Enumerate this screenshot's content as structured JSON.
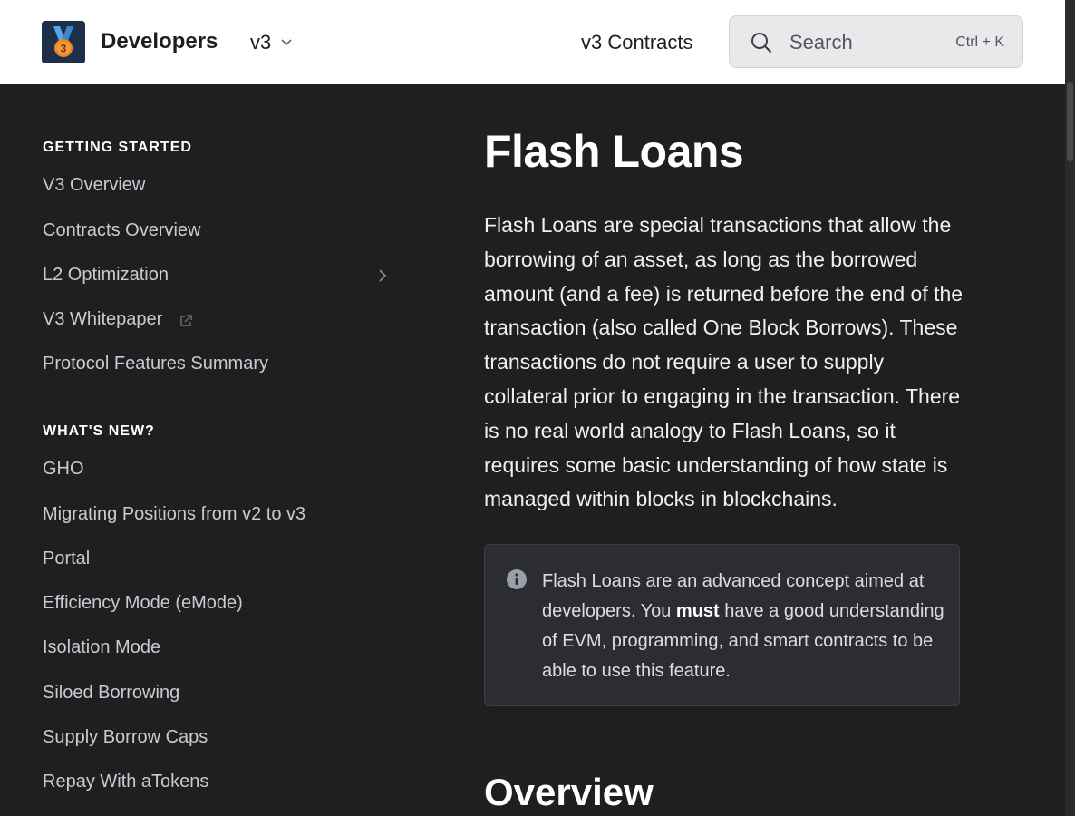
{
  "header": {
    "brand": "Developers",
    "version": "v3",
    "nav_link": "v3 Contracts",
    "search": {
      "label": "Search",
      "shortcut": "Ctrl + K"
    }
  },
  "sidebar": {
    "sections": [
      {
        "title": "GETTING STARTED",
        "items": [
          {
            "label": "V3 Overview"
          },
          {
            "label": "Contracts Overview"
          },
          {
            "label": "L2 Optimization"
          },
          {
            "label": "V3 Whitepaper"
          },
          {
            "label": "Protocol Features Summary"
          }
        ]
      },
      {
        "title": "WHAT'S NEW?",
        "items": [
          {
            "label": "GHO"
          },
          {
            "label": "Migrating Positions from v2 to v3"
          },
          {
            "label": "Portal"
          },
          {
            "label": "Efficiency Mode (eMode)"
          },
          {
            "label": "Isolation Mode"
          },
          {
            "label": "Siloed Borrowing"
          },
          {
            "label": "Supply Borrow Caps"
          },
          {
            "label": "Repay With aTokens"
          }
        ]
      }
    ]
  },
  "main": {
    "title": "Flash Loans",
    "intro": "Flash Loans are special transactions that allow the borrowing of an asset, as long as the borrowed amount (and a fee) is returned before the end of the transaction (also called One Block Borrows). These transactions do not require a user to supply collateral prior to engaging in the transaction. There is no real world analogy to Flash Loans, so it requires some basic understanding of how state is managed within blocks in blockchains.",
    "admonition": {
      "before": "Flash Loans are an advanced concept aimed at developers. You ",
      "bold": "must",
      "after": " have a good understanding of EVM, programming, and smart contracts to be able to use this feature."
    },
    "overview_heading": "Overview"
  },
  "colors": {
    "background": "#1f1f21",
    "header_bg": "#ffffff",
    "admonition_bg": "#2b2d31",
    "text_primary": "#ffffff",
    "text_secondary": "#c9cbcf"
  },
  "icons": {
    "logo": "medal-3-logo",
    "version_dropdown": "chevron-down-icon",
    "search": "search-icon",
    "l2_expand": "chevron-right-icon",
    "whitepaper_external": "external-link-icon",
    "admonition": "info-icon"
  }
}
